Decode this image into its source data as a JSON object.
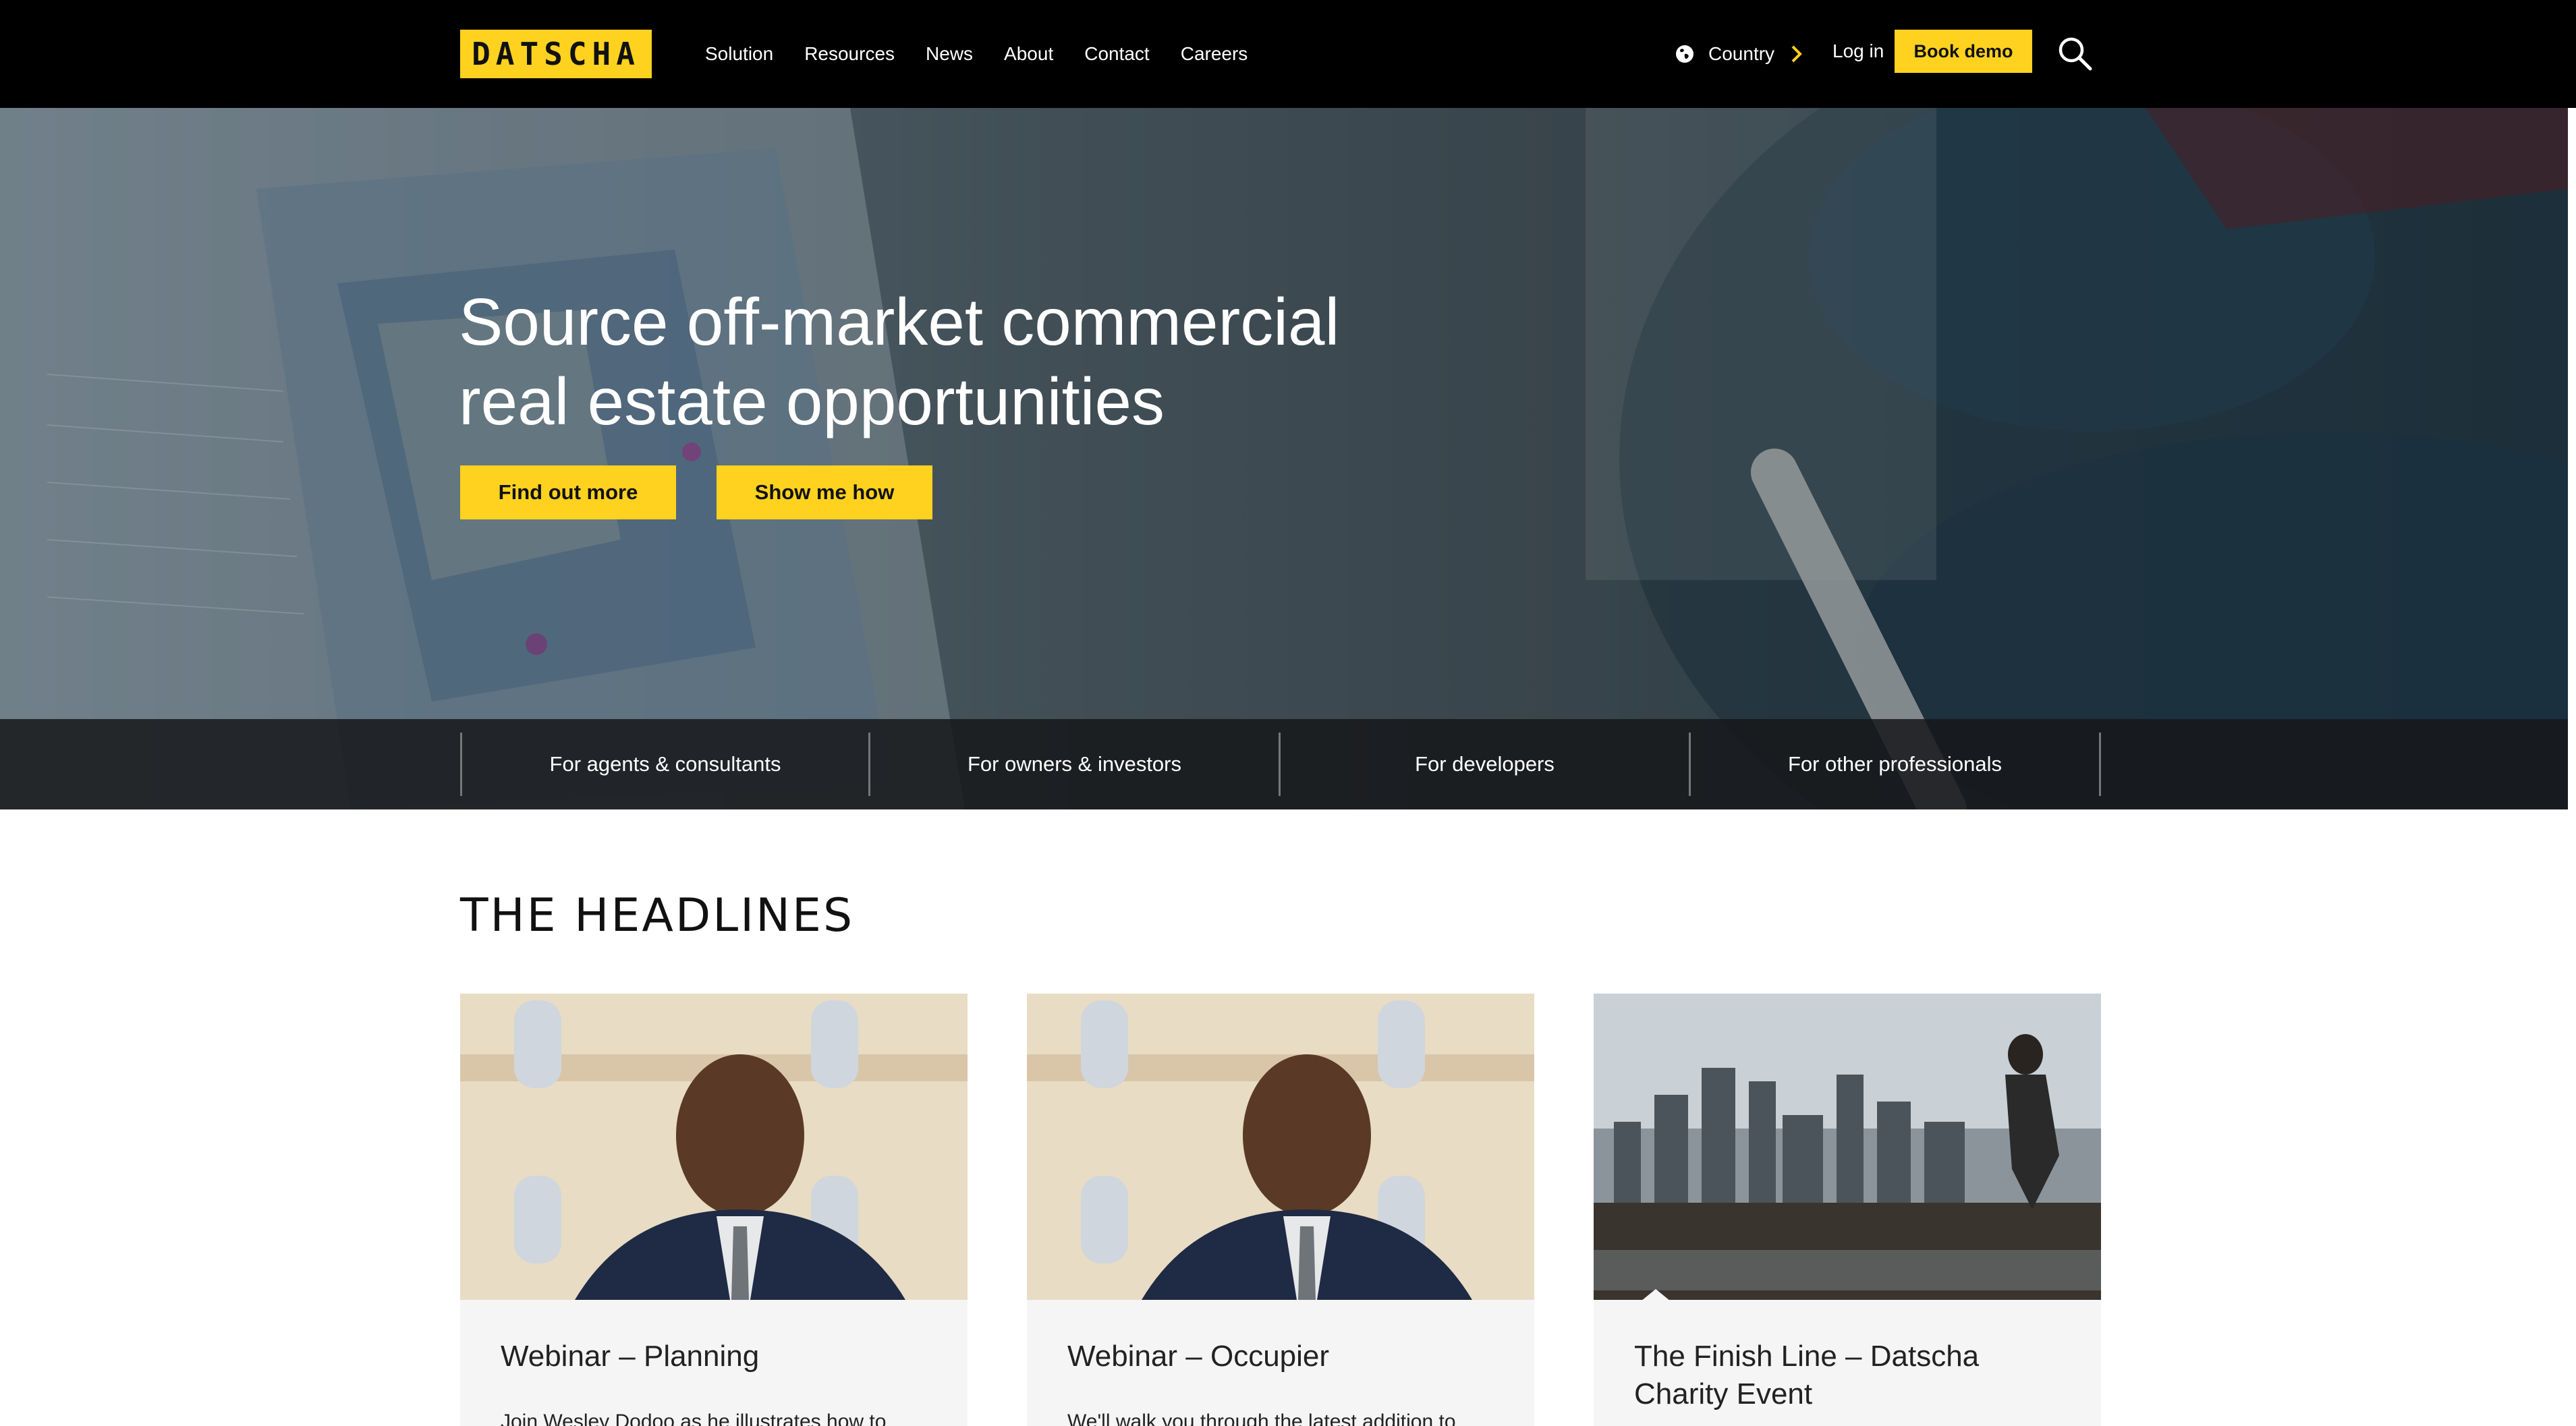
{
  "header": {
    "logo": "DATSCHA",
    "nav": [
      "Solution",
      "Resources",
      "News",
      "About",
      "Contact",
      "Careers"
    ],
    "country_label": "Country",
    "login_label": "Log in",
    "book_demo_label": "Book demo"
  },
  "hero": {
    "title": "Source off-market commercial real estate opportunities",
    "find_out_more": "Find out more",
    "show_me_how": "Show me how"
  },
  "audiences": [
    "For agents & consultants",
    "For owners & investors",
    "For developers",
    "For other professionals"
  ],
  "headlines": {
    "title": "THE HEADLINES",
    "cards": [
      {
        "title": "Webinar – Planning",
        "text": "Join Wesley Dodoo as he illustrates how to"
      },
      {
        "title": "Webinar – Occupier",
        "text": "We'll walk you through the latest addition to"
      },
      {
        "title": "The Finish Line – Datscha Charity Event",
        "text": ""
      }
    ]
  },
  "colors": {
    "brand_yellow": "#ffd21f",
    "header_bg": "#000000",
    "audience_bar": "#16181a"
  },
  "icons": [
    "globe-icon",
    "chevron-right-icon",
    "search-icon"
  ]
}
